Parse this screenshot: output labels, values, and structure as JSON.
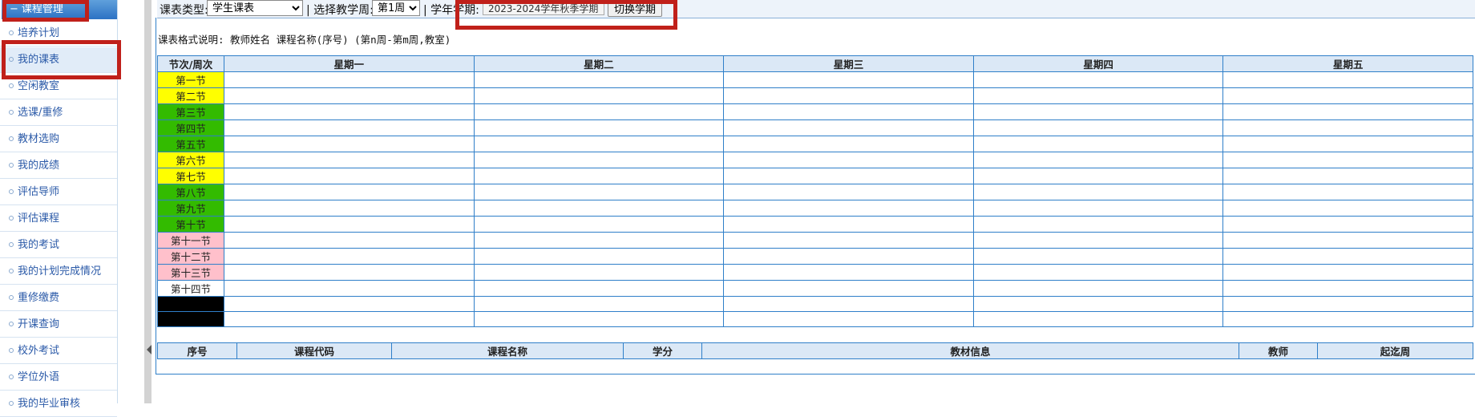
{
  "sidebar": {
    "header": "课程管理",
    "items": [
      {
        "label": "培养计划"
      },
      {
        "label": "我的课表"
      },
      {
        "label": "空闲教室"
      },
      {
        "label": "选课/重修"
      },
      {
        "label": "教材选购"
      },
      {
        "label": "我的成绩"
      },
      {
        "label": "评估导师"
      },
      {
        "label": "评估课程"
      },
      {
        "label": "我的考试"
      },
      {
        "label": "我的计划完成情况"
      },
      {
        "label": "重修缴费"
      },
      {
        "label": "开课查询"
      },
      {
        "label": "校外考试"
      },
      {
        "label": "学位外语"
      },
      {
        "label": "我的毕业审核"
      }
    ]
  },
  "toolbar": {
    "type_label": "课表类型:",
    "type_value": "学生课表",
    "week_label": "| 选择教学周:",
    "week_value": "第1周",
    "term_label": "| 学年学期:",
    "term_value": "2023-2024学年秋季学期",
    "switch_label": "切换学期"
  },
  "format_note": "课表格式说明: 教师姓名 课程名称(序号) (第n周-第m周,教室)",
  "schedule": {
    "corner": "节次/周次",
    "days": [
      "星期一",
      "星期二",
      "星期三",
      "星期四",
      "星期五"
    ],
    "periods": [
      {
        "label": "第一节",
        "color": "#ffff00"
      },
      {
        "label": "第二节",
        "color": "#ffff00"
      },
      {
        "label": "第三节",
        "color": "#33bb00"
      },
      {
        "label": "第四节",
        "color": "#33bb00"
      },
      {
        "label": "第五节",
        "color": "#33bb00"
      },
      {
        "label": "第六节",
        "color": "#ffff00"
      },
      {
        "label": "第七节",
        "color": "#ffff00"
      },
      {
        "label": "第八节",
        "color": "#33bb00"
      },
      {
        "label": "第九节",
        "color": "#33bb00"
      },
      {
        "label": "第十节",
        "color": "#33bb00"
      },
      {
        "label": "第十一节",
        "color": "#ffc0cb"
      },
      {
        "label": "第十二节",
        "color": "#ffc0cb"
      },
      {
        "label": "第十三节",
        "color": "#ffc0cb"
      },
      {
        "label": "第十四节",
        "color": "#ffffff"
      },
      {
        "label": "",
        "color": "#000000"
      },
      {
        "label": "",
        "color": "#000000"
      }
    ]
  },
  "textbook_table": {
    "headers": [
      "序号",
      "课程代码",
      "课程名称",
      "学分",
      "教材信息",
      "教师",
      "起迄周"
    ]
  },
  "colors": {
    "highlight": "#c0201a",
    "border_blue": "#2f7fc9"
  }
}
